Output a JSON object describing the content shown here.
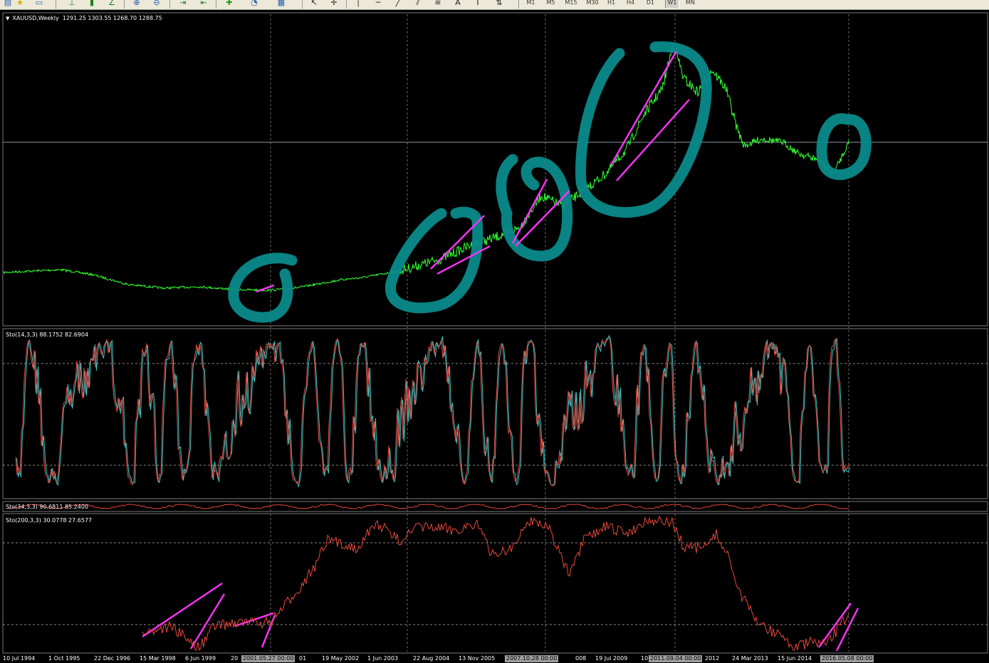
{
  "toolbar": {
    "icons": [
      "chart-folder-icon",
      "star-icon",
      "window-icon",
      "bar-chart-icon",
      "candle-chart-icon",
      "line-chart-icon",
      "zoom-in-icon",
      "zoom-out-icon",
      "scroll-icon",
      "shift-icon",
      "indicator-add-icon",
      "period-icon",
      "template-icon",
      "cursor-icon",
      "crosshair-icon",
      "vertical-line-icon",
      "horizontal-line-icon",
      "trendline-icon",
      "channel-icon",
      "fibo-icon",
      "text-icon",
      "label-icon",
      "arrows-icon"
    ],
    "timeframes": [
      "M1",
      "M5",
      "M15",
      "M30",
      "H1",
      "H4",
      "D1",
      "W1",
      "MN"
    ],
    "active_timeframe": "W1"
  },
  "main_panel": {
    "title": "XAUUSD,Weekly  1291.25 1303.55 1268.70 1288.75",
    "price_color": "#33ff33",
    "annotation_circle_color": "#0a8a8a",
    "annotation_line_color": "#ff33ff"
  },
  "sto14_panel": {
    "label": "Sto(14,3,3) 88.1752 82.6904",
    "main_color": "#e8483c",
    "signal_color": "#33cccc"
  },
  "sto34_panel": {
    "label": "Sto(34,3,3) 90.6811 85.2400"
  },
  "sto200_panel": {
    "label": "Sto(200,3,3) 30.0778 27.6577"
  },
  "x_axis": {
    "labels": [
      "10 Jul 1994",
      "1 Oct 1995",
      "22 Dec 1996",
      "15 Mar 1998",
      "6 Jun 1999",
      "20",
      "01",
      "19 May 2002",
      "1 Jun 2003",
      "22 Aug 2004",
      "13 Nov 2005",
      "008",
      "19 Jul 2009",
      "10",
      "2012",
      "24 Mar 2013",
      "15 Jun 2014"
    ],
    "tags": [
      "2001.05.27 00:00",
      "2007.10.28 00:00",
      "2011.09.04 00:00",
      "2016.05.08 00:00"
    ]
  }
}
